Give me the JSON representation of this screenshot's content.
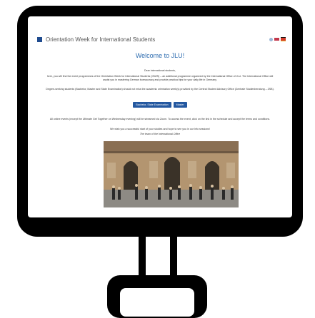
{
  "header": {
    "title": "Orientation Week for International Students",
    "flags": [
      "#2e6db0",
      "#d22e3a",
      "#e5b02a"
    ]
  },
  "main": {
    "welcome": "Welcome to JLU!",
    "greeting": "Dear international students,",
    "para1": "here, you will find the event programmes of the Orientation Week for International Students (OWIS) – an additional programme organized by the International Office of JLU. The International Office will assist you in mastering German bureaucracy and provide practical tips for your daily life in Germany.",
    "para2": "Degree-seeking students (Bachelor, Master and State Examination) should not miss the academic orientation week(s) provided by the Central Student Advisory Office (Zentrale Studienberatung – ZSB).",
    "buttons": [
      "Bachelor, State Examination",
      "Master"
    ],
    "para3": "All online events (except the Ultimate Get Together on Wednesday evening) will be streamed via Zoom. To access the event, click on the link in the schedule and accept the terms and conditions.",
    "para4": "We wish you a successful start of your studies and hope to see you in our Info sessions!",
    "signature": "The team of the International Office"
  }
}
